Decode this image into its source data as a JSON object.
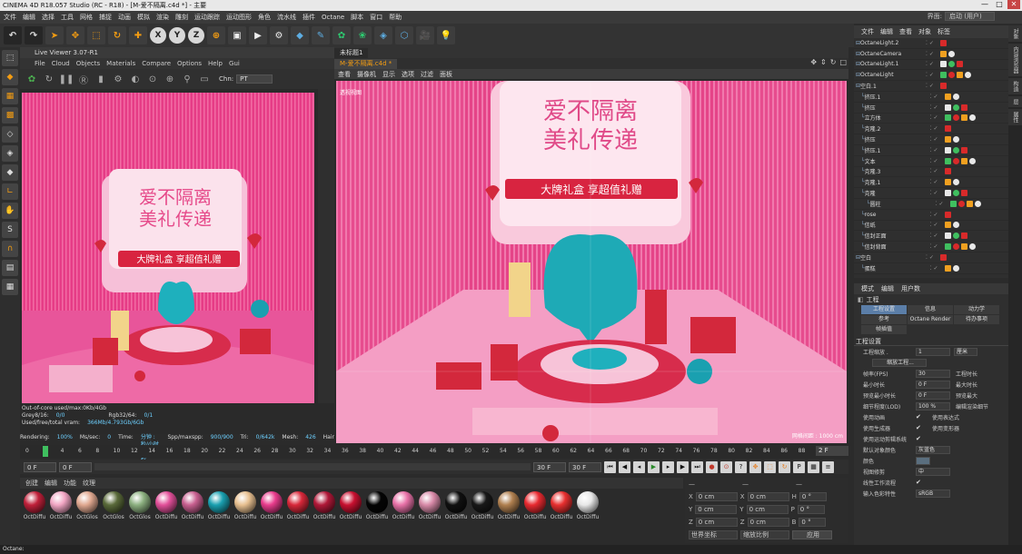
{
  "window": {
    "title": "CINEMA 4D R18.057 Studio (RC - R18) - [M-爱不隔离.c4d *] - 主要",
    "min": "—",
    "max": "□",
    "close": "✕"
  },
  "menubar": [
    "文件",
    "编辑",
    "选择",
    "工具",
    "网格",
    "捕捉",
    "动画",
    "模拟",
    "渲染",
    "雕刻",
    "运动跟踪",
    "运动图形",
    "角色",
    "流水线",
    "插件",
    "Octane",
    "脚本",
    "窗口",
    "帮助"
  ],
  "layout": {
    "label": "界面:",
    "value": "启动 (用户)"
  },
  "toolbar": {
    "undo": "↶",
    "redo": "↷",
    "select": "➤",
    "move": "✥",
    "scale": "⬚",
    "rotate": "↻",
    "add": "✚",
    "x": "X",
    "y": "Y",
    "z": "Z",
    "coord": "⊕",
    "render1": "▣",
    "render2": "▶",
    "render3": "⚙",
    "cube": "◆",
    "pen": "✎",
    "sub": "✿",
    "flower": "❀",
    "deformer": "◈",
    "scene": "⬡",
    "camera": "🎥",
    "light": "💡"
  },
  "live_viewer": {
    "title": "Live Viewer 3.07-R1",
    "menu": [
      "File",
      "Cloud",
      "Objects",
      "Materials",
      "Compare",
      "Options",
      "Help",
      "Gui"
    ],
    "channel_label": "Chn:",
    "channel_value": "PT",
    "stats": {
      "line1": "Out-of-core used/max:0Kb/4Gb",
      "grey_label": "Grey8/16:",
      "grey_val": "0/0",
      "rgb_label": "Rgb32/64:",
      "rgb_val": "0/1",
      "vram_label": "Used/free/total vram:",
      "vram_val": "366Mb/4.793Gb/6Gb",
      "rendering_label": "Rendering:",
      "rendering_val": "100%",
      "mssec_label": "Ms/sec:",
      "mssec_val": "0",
      "time_label": "Time:",
      "time_val": "分钟 : 秒/小时 : 分钟 : 秒",
      "spp_label": "Spp/maxspp:",
      "spp_val": "900/900",
      "tri_label": "Tri:",
      "tri_val": "0/642k",
      "mesh_label": "Mesh:",
      "mesh_val": "426",
      "hair_label": "Hair"
    }
  },
  "viewport": {
    "tabs": [
      "未标题1",
      "M-爱不隔离.c4d *"
    ],
    "menu": [
      "查看",
      "摄像机",
      "显示",
      "选项",
      "过滤",
      "面板"
    ],
    "camera_label": "透视视图",
    "scale_label": "网格间距 : 1000 cm"
  },
  "scene": {
    "title_line1": "爱不隔离",
    "title_line2": "美礼传递",
    "banner": "大牌礼盒 享超值礼赠"
  },
  "timeline": {
    "ticks": [
      "0",
      "2",
      "4",
      "6",
      "8",
      "10",
      "12",
      "14",
      "16",
      "18",
      "20",
      "22",
      "24",
      "26",
      "28",
      "30",
      "32",
      "34",
      "36",
      "38",
      "40",
      "42",
      "44",
      "46",
      "48",
      "50",
      "52",
      "54",
      "56",
      "58",
      "60",
      "62",
      "64",
      "66",
      "68",
      "70",
      "72",
      "74",
      "76",
      "78",
      "80",
      "82",
      "84",
      "86",
      "88",
      "90"
    ],
    "current": "2 F",
    "start": "0 F",
    "start2": "0 F",
    "end": "30 F",
    "end2": "30 F",
    "progress": 0.022
  },
  "materials": {
    "menu": [
      "创建",
      "编辑",
      "功能",
      "纹理"
    ],
    "items": [
      {
        "name": "OctDiffu",
        "color": "#c0203a"
      },
      {
        "name": "OctDiffu",
        "color": "#f2a6c4"
      },
      {
        "name": "OctGlos",
        "color": "#e0a890"
      },
      {
        "name": "OctGlos",
        "color": "#5a6a3a"
      },
      {
        "name": "OctGlos",
        "color": "#8cb080"
      },
      {
        "name": "OctDiffu",
        "color": "#e2509a"
      },
      {
        "name": "OctDiffu",
        "color": "#c86090"
      },
      {
        "name": "OctDiffu",
        "color": "#1aa0b0"
      },
      {
        "name": "OctDiffu",
        "color": "#e8c090"
      },
      {
        "name": "OctDiffu",
        "color": "#e83c8c"
      },
      {
        "name": "OctDiffu",
        "color": "#d8283a"
      },
      {
        "name": "OctDiffu",
        "color": "#b01838"
      },
      {
        "name": "OctDiffu",
        "color": "#c81030"
      },
      {
        "name": "OctDiffu",
        "color": "#050505"
      },
      {
        "name": "OctDiffu",
        "color": "#e872a8"
      },
      {
        "name": "OctDiffu",
        "color": "#d88aa8"
      },
      {
        "name": "OctDiffu",
        "color": "#101010"
      },
      {
        "name": "OctDiffu",
        "color": "#181818"
      },
      {
        "name": "OctDiffu",
        "color": "#b08050"
      },
      {
        "name": "OctDiffu",
        "color": "#e82a30"
      },
      {
        "name": "OctDiffu",
        "color": "#e83030"
      },
      {
        "name": "OctDiffu",
        "color": "#e8e8e8"
      }
    ]
  },
  "coords": {
    "headers": [
      "— ",
      "— ",
      "— "
    ],
    "rows": [
      {
        "a": "X",
        "av": "0 cm",
        "b": "X",
        "bv": "0 cm",
        "c": "H",
        "cv": "0 °"
      },
      {
        "a": "Y",
        "av": "0 cm",
        "b": "Y",
        "bv": "0 cm",
        "c": "P",
        "cv": "0 °"
      },
      {
        "a": "Z",
        "av": "0 cm",
        "b": "Z",
        "bv": "0 cm",
        "c": "B",
        "cv": "0 °"
      }
    ],
    "mode1": "世界坐标",
    "mode2": "缩放比例",
    "apply": "应用"
  },
  "objects": {
    "menu": [
      "文件",
      "编辑",
      "查看",
      "对象",
      "标签"
    ],
    "rows": [
      {
        "name": "OctaneLight.2",
        "indent": 0
      },
      {
        "name": "OctaneCamera",
        "indent": 0
      },
      {
        "name": "OctaneLight.1",
        "indent": 0
      },
      {
        "name": "OctaneLight",
        "indent": 0
      },
      {
        "name": "空白.1",
        "indent": 0
      },
      {
        "name": "挤压.1",
        "indent": 1
      },
      {
        "name": "挤压",
        "indent": 1
      },
      {
        "name": "立方体",
        "indent": 1
      },
      {
        "name": "克隆.2",
        "indent": 1
      },
      {
        "name": "挤压",
        "indent": 1
      },
      {
        "name": "挤压.1",
        "indent": 1
      },
      {
        "name": "文本",
        "indent": 1
      },
      {
        "name": "克隆.3",
        "indent": 1
      },
      {
        "name": "克隆.1",
        "indent": 1
      },
      {
        "name": "克隆",
        "indent": 1
      },
      {
        "name": "圆柱",
        "indent": 2
      },
      {
        "name": "rose",
        "indent": 1
      },
      {
        "name": "信纸",
        "indent": 1
      },
      {
        "name": "信封正面",
        "indent": 1
      },
      {
        "name": "信封背面",
        "indent": 1
      },
      {
        "name": "空白",
        "indent": 0
      },
      {
        "name": "蛋糕",
        "indent": 1
      }
    ]
  },
  "attributes": {
    "menu": [
      "模式",
      "编辑",
      "用户数"
    ],
    "title": "工程",
    "tabs": [
      "工程设置",
      "信息",
      "动力学",
      "参考",
      "Octane Render",
      "待办事项",
      "帧插值"
    ],
    "section": "工程设置",
    "scale_label": "工程缩放 .",
    "scale_val": "1",
    "scale_unit": "厘米",
    "scale_btn": "缩放工程...",
    "fps_label": "帧率(FPS)",
    "fps_val": "30",
    "fps_right": "工程时长",
    "min_label": "最小时长",
    "min_val": "0 F",
    "min_right": "最大时长",
    "preview_min_label": "预览最小时长",
    "preview_min_val": "0 F",
    "preview_min_right": "预览最大",
    "lod_label": "细节程度(LOD)",
    "lod_val": "100 %",
    "lod_right": "编辑渲染细节",
    "use_anim": "使用动画",
    "use_expr": "使用表达式",
    "use_gen": "使用生成器",
    "use_def": "使用变形器",
    "use_motion": "使用运动剪辑系统",
    "def_color_label": "默认对象颜色",
    "def_color_val": "灰蓝色",
    "color_label": "颜色",
    "view_clip_label": "视图修剪",
    "view_clip_val": "中",
    "linear_label": "线性工作流程",
    "input_label": "输入色彩特性",
    "input_val": "sRGB"
  },
  "side_tabs": [
    "对象",
    "内容浏览器",
    "构造",
    "层",
    "属性"
  ],
  "status": "Octane:"
}
